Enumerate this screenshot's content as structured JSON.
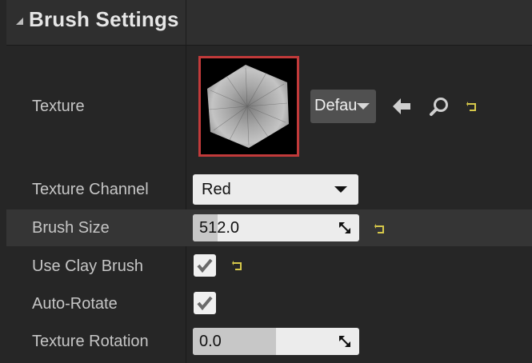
{
  "header": {
    "title": "Brush Settings"
  },
  "rows": {
    "texture": {
      "label": "Texture",
      "asset_value": "Default"
    },
    "texture_channel": {
      "label": "Texture Channel",
      "value": "Red"
    },
    "brush_size": {
      "label": "Brush Size",
      "value": "512.0",
      "slider_fraction": 0.15
    },
    "use_clay_brush": {
      "label": "Use Clay Brush",
      "checked": true
    },
    "auto_rotate": {
      "label": "Auto-Rotate",
      "checked": true
    },
    "texture_rotation": {
      "label": "Texture Rotation",
      "value": "0.0",
      "slider_fraction": 0.5
    }
  },
  "colors": {
    "accent_reset": "#d6c84a",
    "thumb_border": "#c13a3a"
  },
  "icons": [
    "expand-triangle-icon",
    "arrow-left-icon",
    "search-icon",
    "reset-arrow-icon",
    "dropdown-arrow-icon",
    "drag-resize-icon",
    "checkmark-icon"
  ]
}
